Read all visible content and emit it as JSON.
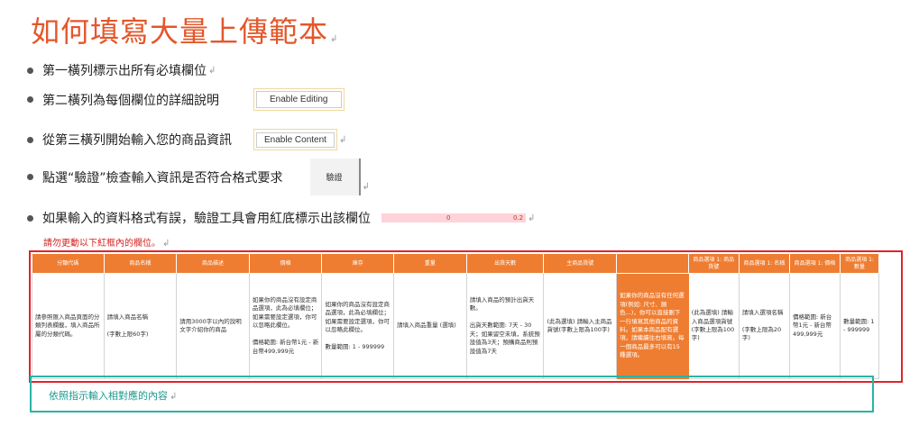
{
  "title": "如何填寫大量上傳範本",
  "bullets": {
    "b1": "第一橫列標示出所有必填欄位",
    "b2": "第二橫列為每個欄位的詳細說明",
    "b2_button": "Enable Editing",
    "b3": "從第三橫列開始輸入您的商品資訊",
    "b3_button": "Enable Content",
    "b4": "點選“驗證”檢查輸入資訊是否符合格式要求",
    "b4_button": "驗證",
    "b5": "如果輸入的資料格式有誤，驗證工具會用紅底標示出該欄位",
    "b5_bar_left": "0",
    "b5_bar_right": "0.2"
  },
  "warning": "請勿更動以下紅框內的欄位。",
  "instruction": "依照指示輸入相對應的內容",
  "table": {
    "headers": [
      "分類代碼",
      "商品名稱",
      "商品描述",
      "價格",
      "庫存",
      "重量",
      "出貨天數",
      "主商品貨號",
      "",
      "商品選項 1: 商品貨號",
      "商品選項 1: 名稱",
      "商品選項 1: 價格",
      "商品選項 1: 數量"
    ],
    "descriptions": [
      "請參照匯入商品頁面的分類列表欄載，填入商品所屬的分類代碼。",
      "請填入商品名稱\n\n(字數上限60字)",
      "請用3000字以內的說明文字介紹你的商品",
      "如果你的商品沒有設定商品選項，此為必填欄位；如果需要設定選項，你可以忽略此欄位。\n\n價格範圍: 新台幣1元 - 新台幣499,999元",
      "如果你的商品沒有設定商品選項，此為必填欄位；如果需要設定選項，你可以忽略此欄位。\n\n數量範圍: 1 - 999999",
      "請填入商品重量 (選填)",
      "請填入商品的預計出貨天數。\n\n出貨天數範圍: 7天 - 30天；如果留空未填，系統預設值為3天；預購商品則預設值為7天",
      "(此為選填) 請輸入主商品貨號(字數上限為100字)",
      "如果你的商品沒有任何選項(例如: 尺寸、顏色...)，你可以直接刪下一行填寫其他商品的資料。如果本商品配有選項，請繼續往右填寫。每一個商品最多可以有15種選項。",
      "(此為選填) 請輸入商品選項貨號(字數上限為100字)",
      "請填入選項名稱\n\n(字數上限為20字)",
      "價格範圍: 新台幣1元 - 新台幣499,999元",
      "數量範圍: 1 - 999999"
    ]
  },
  "colors": {
    "title": "#e3572b",
    "header_orange": "#ef7d31",
    "red_frame": "#e0242a",
    "teal_frame": "#2ab3a6",
    "error_pink": "#ffd3d9"
  }
}
